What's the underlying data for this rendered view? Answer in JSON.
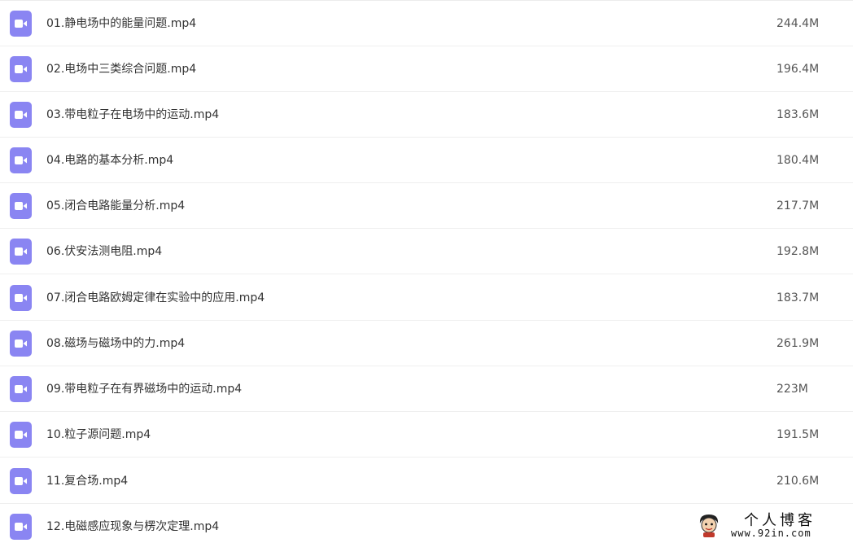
{
  "colors": {
    "icon_background": "#8a85f2",
    "icon_glyph": "#ffffff",
    "text": "#333333",
    "row_divider": "#efefef"
  },
  "file_icon": "video-file-icon",
  "files": [
    {
      "name": "01.静电场中的能量问题.mp4",
      "size": "244.4M"
    },
    {
      "name": "02.电场中三类综合问题.mp4",
      "size": "196.4M"
    },
    {
      "name": "03.带电粒子在电场中的运动.mp4",
      "size": "183.6M"
    },
    {
      "name": "04.电路的基本分析.mp4",
      "size": "180.4M"
    },
    {
      "name": "05.闭合电路能量分析.mp4",
      "size": "217.7M"
    },
    {
      "name": "06.伏安法测电阻.mp4",
      "size": "192.8M"
    },
    {
      "name": "07.闭合电路欧姆定律在实验中的应用.mp4",
      "size": "183.7M"
    },
    {
      "name": "08.磁场与磁场中的力.mp4",
      "size": "261.9M"
    },
    {
      "name": "09.带电粒子在有界磁场中的运动.mp4",
      "size": "223M"
    },
    {
      "name": "10.粒子源问题.mp4",
      "size": "191.5M"
    },
    {
      "name": "11.复合场.mp4",
      "size": "210.6M"
    },
    {
      "name": "12.电磁感应现象与楞次定理.mp4",
      "size": ""
    }
  ],
  "watermark": {
    "title": "个人博客",
    "url": "www.92in.com",
    "mascot_icon": "cartoon-mascot-icon"
  }
}
